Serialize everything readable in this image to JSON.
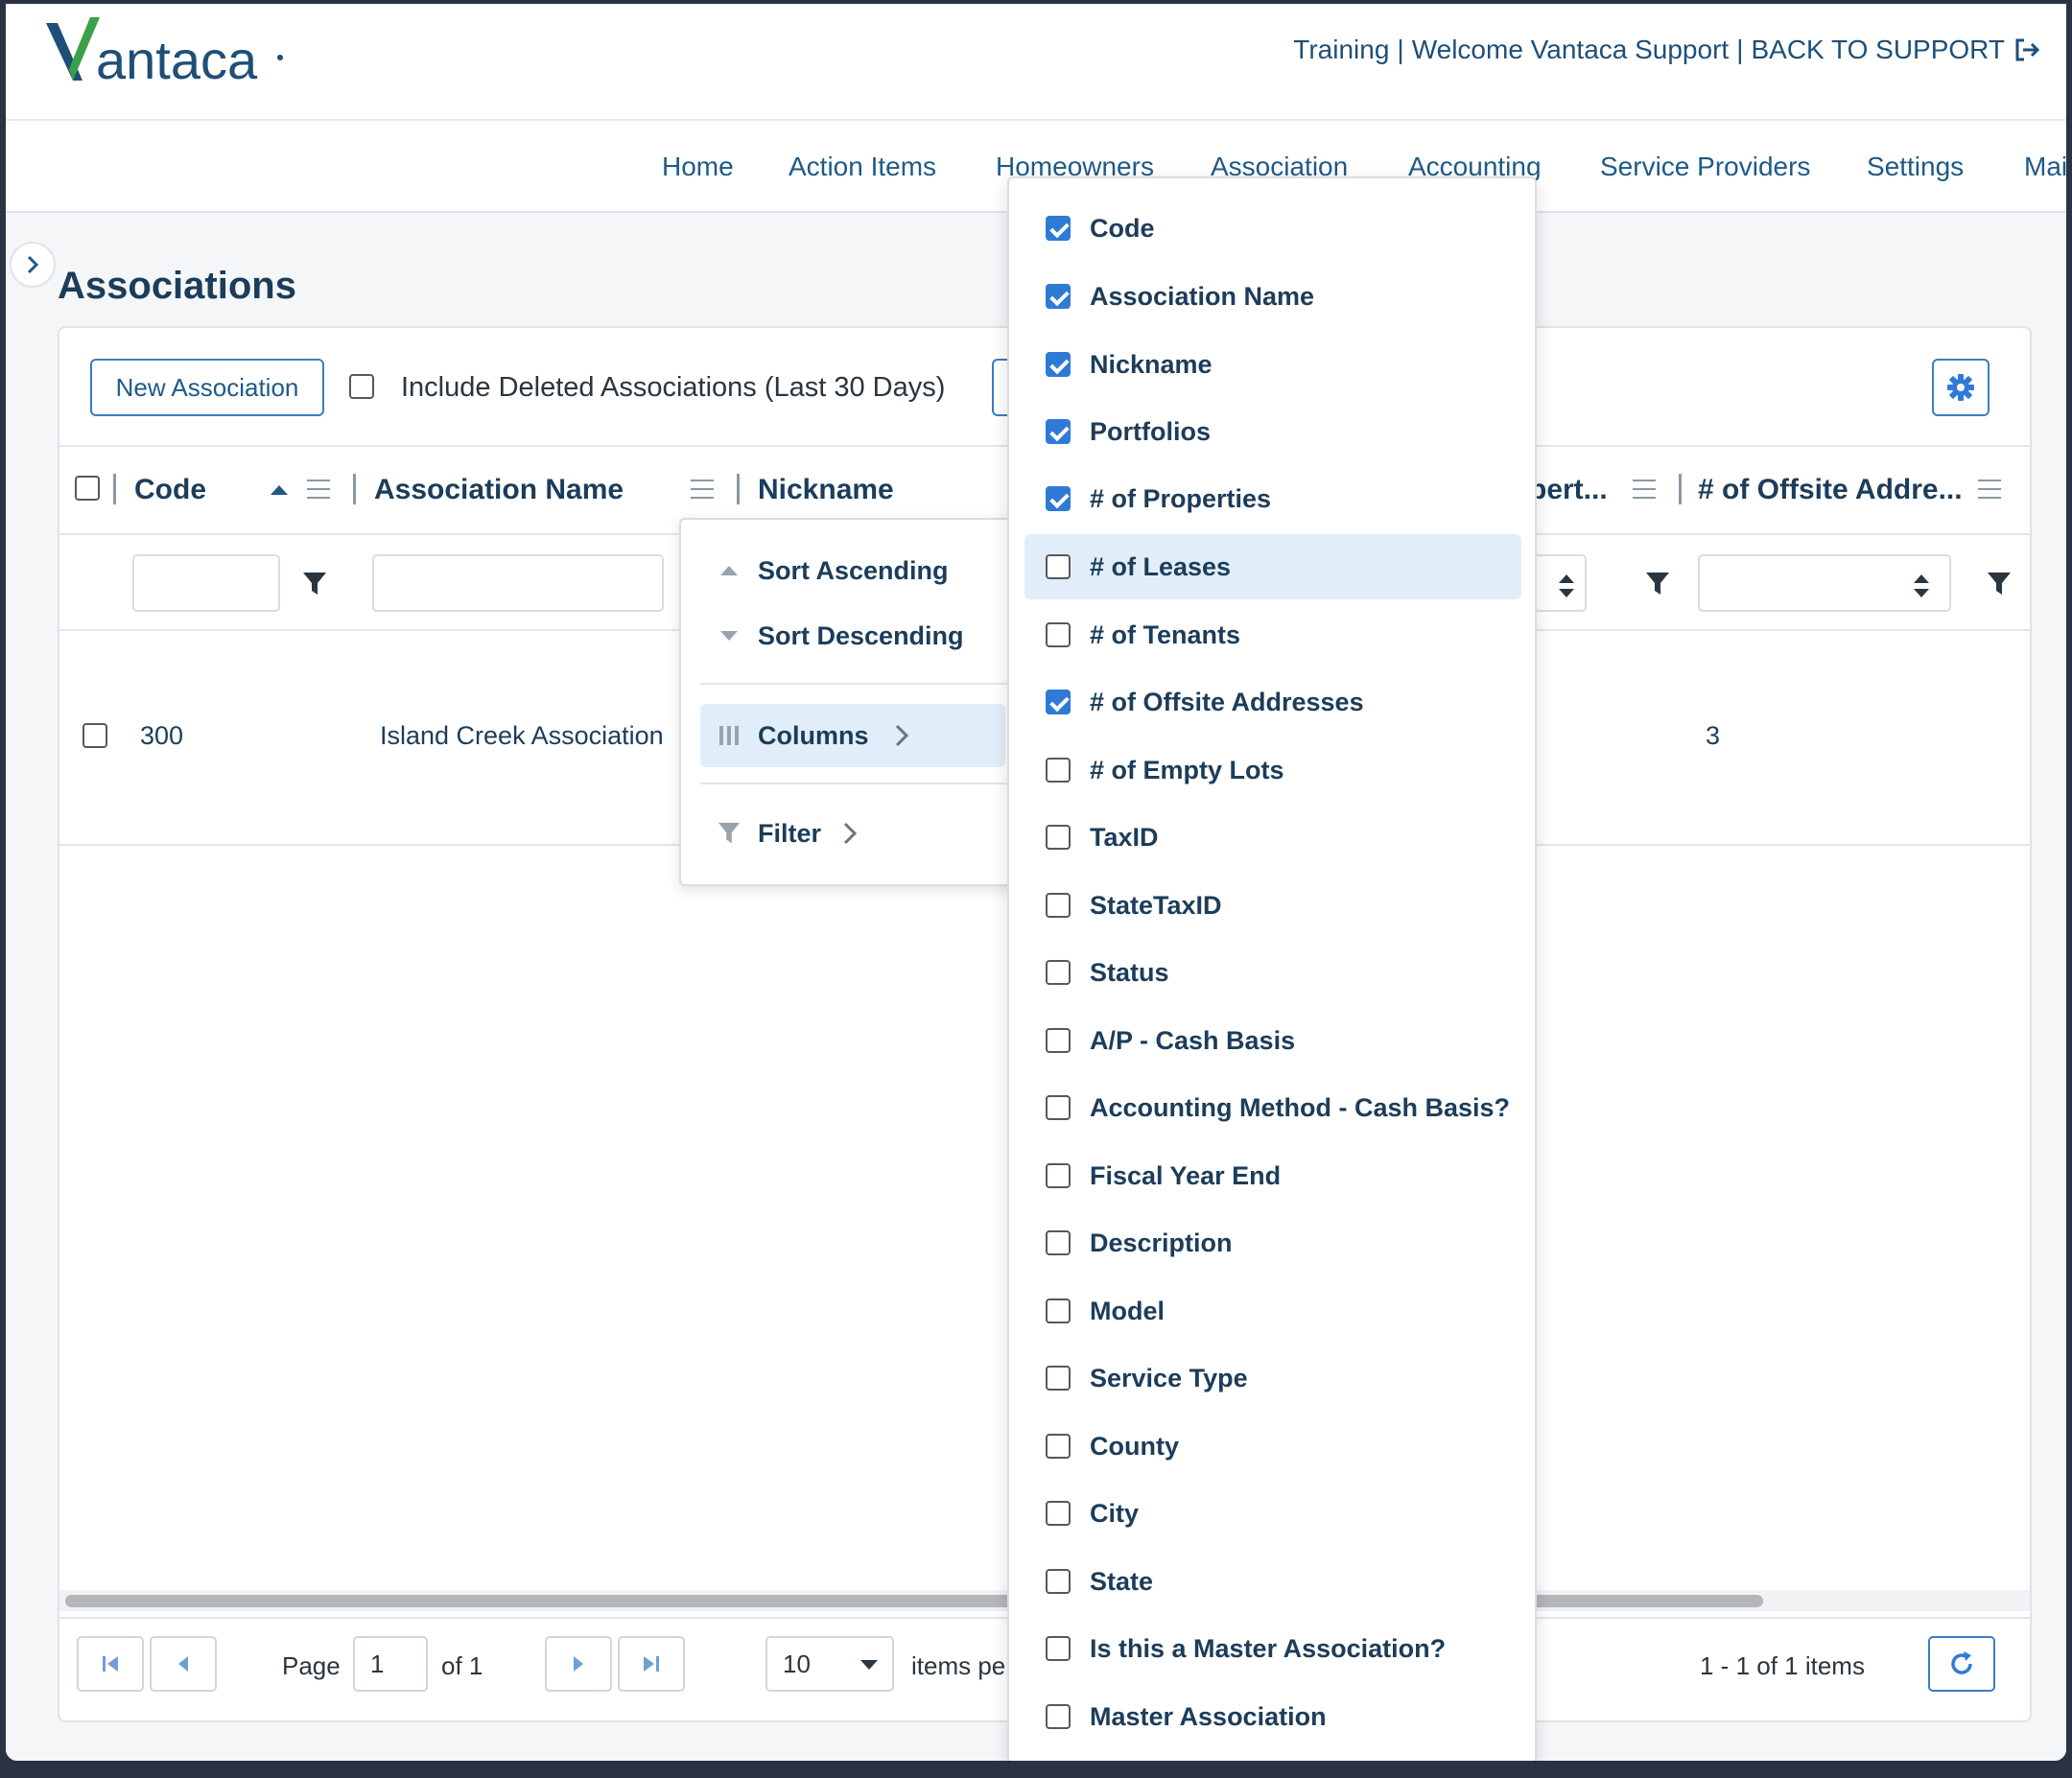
{
  "brand": {
    "logo_text": "Vantaca",
    "logo_v_color": "#3aa04a",
    "logo_text_color": "#1e4f78"
  },
  "top_links": {
    "training": "Training",
    "sep1": "|",
    "welcome": "Welcome Vantaca Support",
    "sep2": "|",
    "back": "BACK TO SUPPORT"
  },
  "nav": [
    "Home",
    "Action Items",
    "Homeowners",
    "Association",
    "Accounting",
    "Service Providers",
    "Settings",
    "Mai"
  ],
  "page": {
    "title": "Associations"
  },
  "toolbar": {
    "new_button": "New Association",
    "include_deleted": "Include Deleted Associations (Last 30 Days)"
  },
  "columns": {
    "code": "Code",
    "association_name": "Association Name",
    "nickname": "Nickname",
    "properties_trunc": "pert...",
    "offsite_trunc": "# of Offsite Addre..."
  },
  "row": {
    "code": "300",
    "name": "Island Creek Association",
    "offsite": "3"
  },
  "column_menu": {
    "sort_asc": "Sort Ascending",
    "sort_desc": "Sort Descending",
    "columns": "Columns",
    "filter": "Filter"
  },
  "columns_list": [
    {
      "label": "Code",
      "checked": true
    },
    {
      "label": "Association Name",
      "checked": true
    },
    {
      "label": "Nickname",
      "checked": true
    },
    {
      "label": "Portfolios",
      "checked": true
    },
    {
      "label": "# of Properties",
      "checked": true
    },
    {
      "label": "# of Leases",
      "checked": false
    },
    {
      "label": "# of Tenants",
      "checked": false
    },
    {
      "label": "# of Offsite Addresses",
      "checked": true
    },
    {
      "label": "# of Empty Lots",
      "checked": false
    },
    {
      "label": "TaxID",
      "checked": false
    },
    {
      "label": "StateTaxID",
      "checked": false
    },
    {
      "label": "Status",
      "checked": false
    },
    {
      "label": "A/P - Cash Basis",
      "checked": false
    },
    {
      "label": "Accounting Method - Cash Basis?",
      "checked": false
    },
    {
      "label": "Fiscal Year End",
      "checked": false
    },
    {
      "label": "Description",
      "checked": false
    },
    {
      "label": "Model",
      "checked": false
    },
    {
      "label": "Service Type",
      "checked": false
    },
    {
      "label": "County",
      "checked": false
    },
    {
      "label": "City",
      "checked": false
    },
    {
      "label": "State",
      "checked": false
    },
    {
      "label": "Is this a Master Association?",
      "checked": false
    },
    {
      "label": "Master Association",
      "checked": false
    }
  ],
  "highlighted_column": "# of Leases",
  "pager": {
    "page_label": "Page",
    "page_value": "1",
    "of_label": "of 1",
    "page_size": "10",
    "items_per": "items pe",
    "summary": "1 - 1 of 1 items"
  },
  "colors": {
    "accent": "#2f7ad6",
    "text_dark": "#1c3d5a",
    "link": "#1e5a86",
    "highlight": "#e1eef9"
  }
}
